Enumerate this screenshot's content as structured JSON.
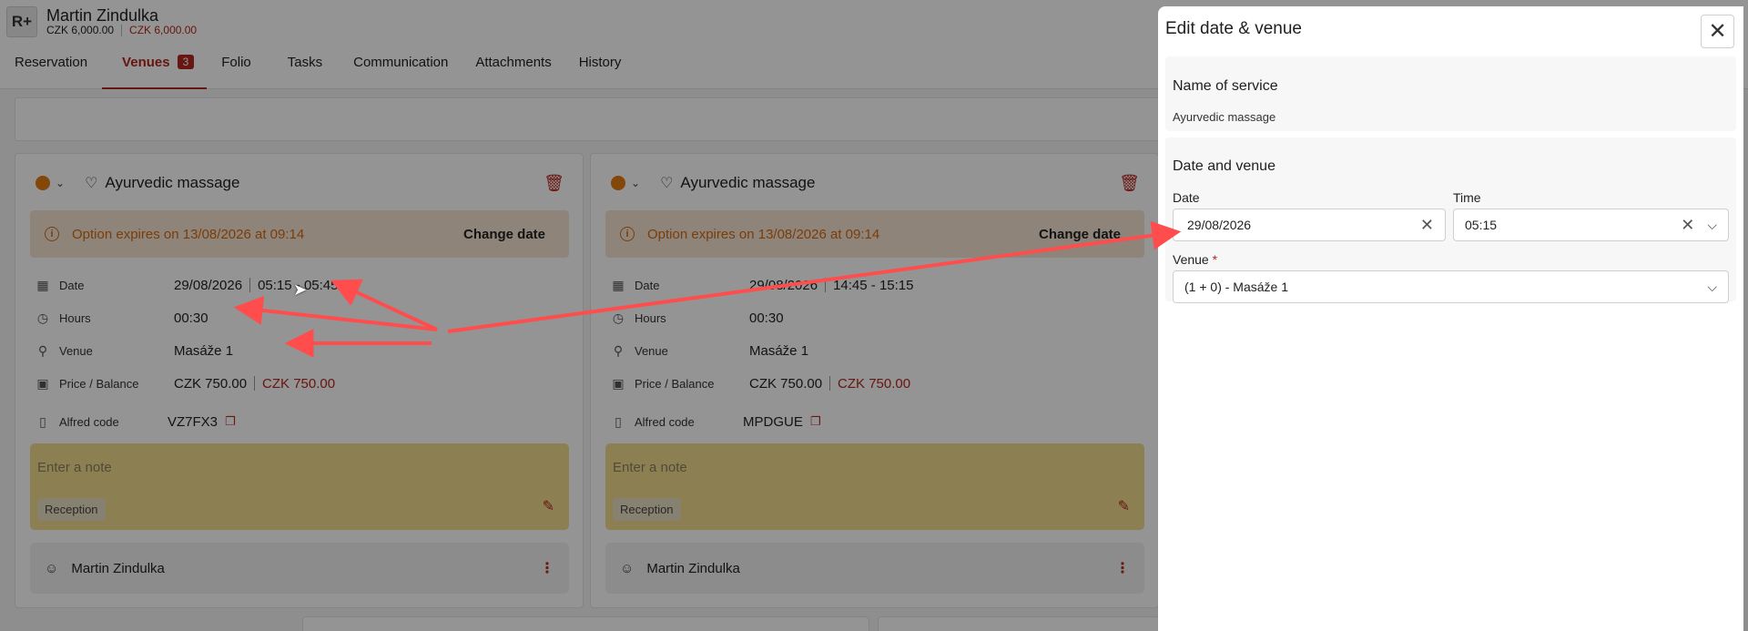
{
  "header": {
    "logo_text": "R+",
    "guest_name": "Martin Zindulka",
    "amount_total": "CZK 6,000.00",
    "amount_balance": "CZK 6,000.00"
  },
  "tabs": [
    {
      "label": "Reservation"
    },
    {
      "label": "Venues",
      "badge": "3"
    },
    {
      "label": "Folio"
    },
    {
      "label": "Tasks"
    },
    {
      "label": "Communication"
    },
    {
      "label": "Attachments"
    },
    {
      "label": "History"
    }
  ],
  "cards": [
    {
      "service_title": "Ayurvedic massage",
      "option_message": "Option expires on 13/08/2026 at 09:14",
      "change_date_label": "Change date",
      "rows": {
        "date_label": "Date",
        "date_value": "29/08/2026",
        "time_value": "05:15 - 05:45",
        "hours_label": "Hours",
        "hours_value": "00:30",
        "venue_label": "Venue",
        "venue_value": "Masáže 1",
        "price_label": "Price / Balance",
        "price_value": "CZK 750.00",
        "balance_value": "CZK 750.00",
        "alfred_label": "Alfred code",
        "alfred_value": "VZ7FX3"
      },
      "note_placeholder": "Enter a note",
      "note_chip": "Reception",
      "assignee": "Martin Zindulka"
    },
    {
      "service_title": "Ayurvedic massage",
      "option_message": "Option expires on 13/08/2026 at 09:14",
      "change_date_label": "Change date",
      "rows": {
        "date_label": "Date",
        "date_value": "29/08/2026",
        "time_value": "14:45 - 15:15",
        "hours_label": "Hours",
        "hours_value": "00:30",
        "venue_label": "Venue",
        "venue_value": "Masáže 1",
        "price_label": "Price / Balance",
        "price_value": "CZK 750.00",
        "balance_value": "CZK 750.00",
        "alfred_label": "Alfred code",
        "alfred_value": "MPDGUE"
      },
      "note_placeholder": "Enter a note",
      "note_chip": "Reception",
      "assignee": "Martin Zindulka"
    }
  ],
  "panel": {
    "title": "Edit date & venue",
    "service_section_title": "Name of service",
    "service_name": "Ayurvedic massage",
    "date_section_title": "Date and venue",
    "date_label": "Date",
    "date_value": "29/08/2026",
    "time_label": "Time",
    "time_value": "05:15",
    "venue_label": "Venue",
    "venue_required_mark": "*",
    "venue_value": "(1 + 0) - Masáže 1"
  },
  "colors": {
    "accent": "#b3261e",
    "warning_text": "#d06a12",
    "warning_bg": "#f6e4d2",
    "note_bg": "#f2dc8f",
    "annotation_arrow": "#ff4d4d"
  }
}
